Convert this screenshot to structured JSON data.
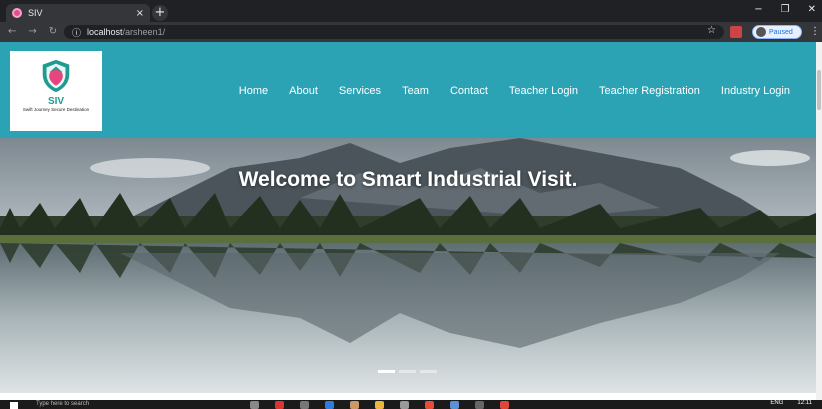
{
  "browser": {
    "tab_title": "SIV",
    "tab_close": "×",
    "new_tab": "+",
    "url_host": "localhost",
    "url_path": "/arsheen1/",
    "profile_status": "Paused",
    "window_controls": [
      "−",
      "❐",
      "✕"
    ]
  },
  "site": {
    "logo_name": "SIV",
    "logo_tagline": "Swift Journey Secure Destination",
    "nav": [
      "Home",
      "About",
      "Services",
      "Team",
      "Contact",
      "Teacher Login",
      "Teacher Registration",
      "Industry Login"
    ]
  },
  "hero": {
    "title": "Welcome to Smart Industrial Visit."
  },
  "taskbar": {
    "search_placeholder": "Type here to search",
    "language": "ENG",
    "time": "12:11"
  },
  "colors": {
    "header_bg": "#2ba3b4",
    "logo_accent": "#1f9b8f"
  }
}
